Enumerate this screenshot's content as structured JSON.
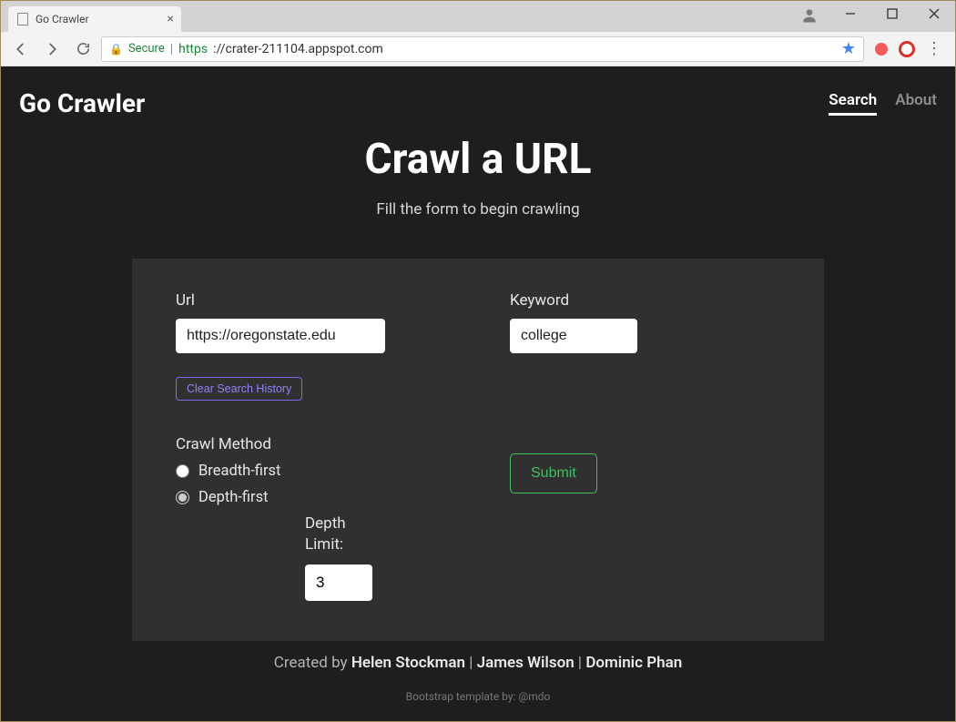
{
  "browser": {
    "tab_title": "Go Crawler",
    "secure_label": "Secure",
    "url_protocol": "https",
    "url_rest": "://crater-211104.appspot.com"
  },
  "header": {
    "brand": "Go Crawler",
    "nav_search": "Search",
    "nav_about": "About"
  },
  "hero": {
    "title": "Crawl a URL",
    "subtitle": "Fill the form to begin crawling"
  },
  "form": {
    "url_label": "Url",
    "url_value": "https://oregonstate.edu",
    "keyword_label": "Keyword",
    "keyword_value": "college",
    "clear_history_label": "Clear Search History",
    "method_label": "Crawl Method",
    "breadth_label": "Breadth-first",
    "depth_label_radio": "Depth-first",
    "depth_limit_label_1": "Depth",
    "depth_limit_label_2": "Limit:",
    "depth_value": "3",
    "submit_label": "Submit"
  },
  "footer": {
    "created_by_prefix": "Created by ",
    "author1": "Helen Stockman",
    "sep": " | ",
    "author2": "James Wilson",
    "author3": "Dominic Phan",
    "template_credit": "Bootstrap template by: @mdo"
  }
}
